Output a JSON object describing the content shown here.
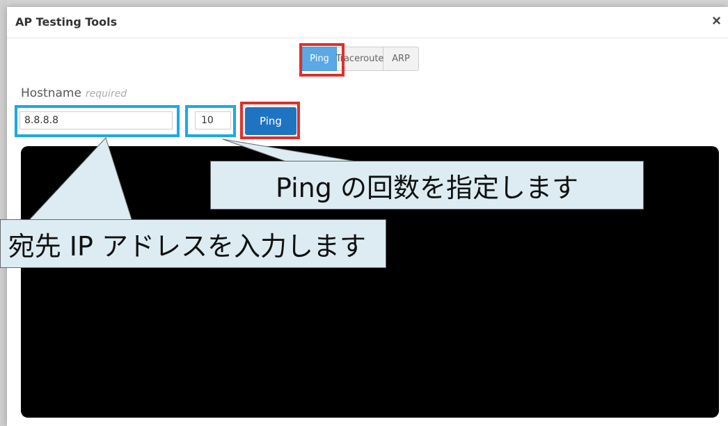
{
  "dialog": {
    "title": "AP Testing Tools",
    "close_label": "×"
  },
  "tabs": [
    {
      "label": "Ping",
      "active": true
    },
    {
      "label": "Traceroute",
      "active": false
    },
    {
      "label": "ARP",
      "active": false
    }
  ],
  "form": {
    "hostname_label": "Hostname",
    "hostname_required": "required",
    "hostname_value": "8.8.8.8",
    "count_value": "10",
    "ping_button_label": "Ping"
  },
  "annotations": {
    "count_callout": "Ping の回数を指定します",
    "hostname_callout": "宛先 IP アドレスを入力します"
  },
  "colors": {
    "highlight_red": "#e0302a",
    "highlight_blue": "#1aa9e6",
    "active_tab": "#5aa9e6",
    "primary_button": "#1f74c2",
    "callout_bg": "#dcecf2"
  }
}
